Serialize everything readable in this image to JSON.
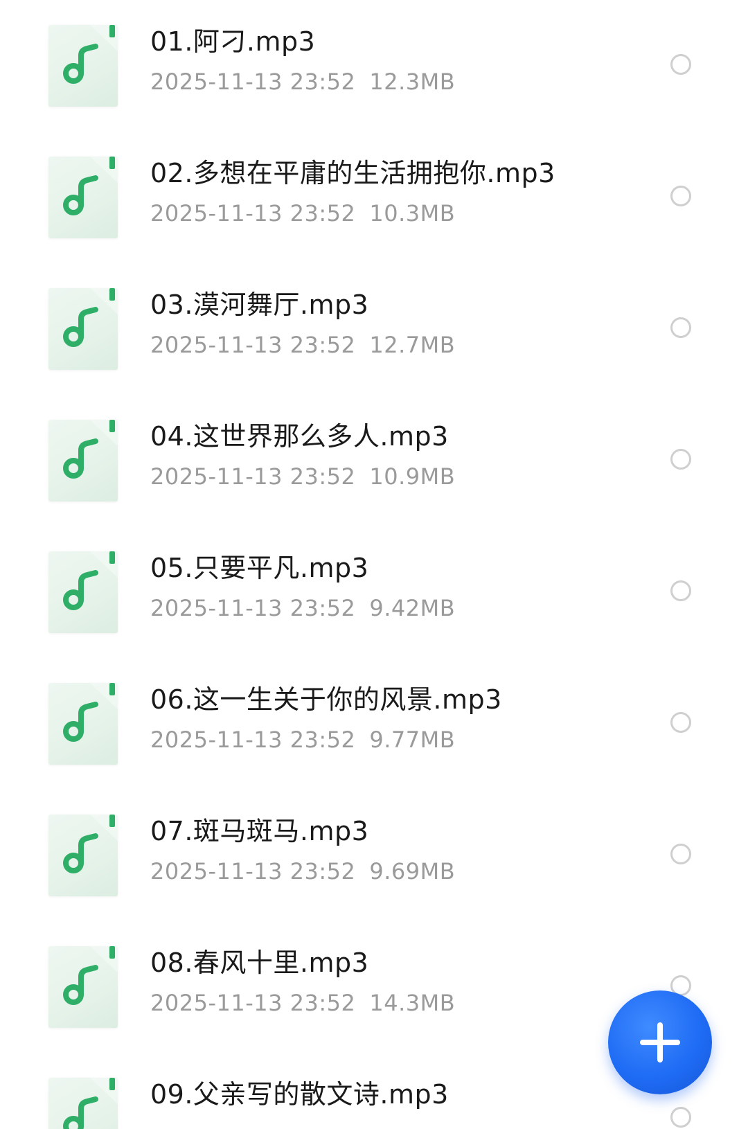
{
  "files": [
    {
      "name": "01.阿刁.mp3",
      "date": "2025-11-13 23:52",
      "size": "12.3MB"
    },
    {
      "name": "02.多想在平庸的生活拥抱你.mp3",
      "date": "2025-11-13 23:52",
      "size": "10.3MB"
    },
    {
      "name": "03.漠河舞厅.mp3",
      "date": "2025-11-13 23:52",
      "size": "12.7MB"
    },
    {
      "name": "04.这世界那么多人.mp3",
      "date": "2025-11-13 23:52",
      "size": "10.9MB"
    },
    {
      "name": "05.只要平凡.mp3",
      "date": "2025-11-13 23:52",
      "size": "9.42MB"
    },
    {
      "name": "06.这一生关于你的风景.mp3",
      "date": "2025-11-13 23:52",
      "size": "9.77MB"
    },
    {
      "name": "07.斑马斑马.mp3",
      "date": "2025-11-13 23:52",
      "size": "9.69MB"
    },
    {
      "name": "08.春风十里.mp3",
      "date": "2025-11-13 23:52",
      "size": "14.3MB"
    },
    {
      "name": "09.父亲写的散文诗.mp3",
      "date": "",
      "size": ""
    }
  ],
  "icons": {
    "file_type": "music-note-icon",
    "fab": "plus-icon"
  },
  "colors": {
    "note_green": "#2fae68",
    "fab_blue": "#1f6cf5",
    "meta_gray": "#9a9a9a"
  }
}
